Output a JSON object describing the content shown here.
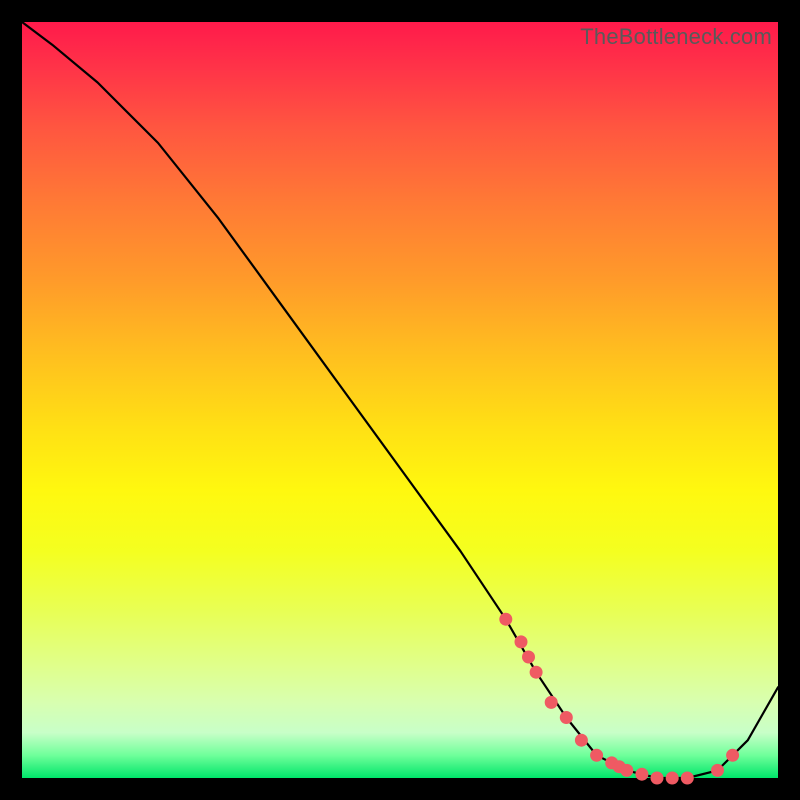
{
  "watermark": "TheBottleneck.com",
  "colors": {
    "frame_bg": "#000000",
    "marker": "#ef5a63",
    "curve": "#000000"
  },
  "chart_data": {
    "type": "line",
    "title": "",
    "xlabel": "",
    "ylabel": "",
    "xlim": [
      0,
      100
    ],
    "ylim": [
      0,
      100
    ],
    "series": [
      {
        "name": "bottleneck-curve",
        "x": [
          0,
          4,
          10,
          18,
          26,
          34,
          42,
          50,
          58,
          64,
          68,
          72,
          76,
          80,
          84,
          88,
          92,
          96,
          100
        ],
        "y": [
          100,
          97,
          92,
          84,
          74,
          63,
          52,
          41,
          30,
          21,
          14,
          8,
          3,
          1,
          0,
          0,
          1,
          5,
          12
        ]
      }
    ],
    "markers": {
      "name": "highlight-points",
      "x": [
        64,
        66,
        67,
        68,
        70,
        72,
        74,
        76,
        78,
        79,
        80,
        82,
        84,
        86,
        88,
        92,
        94
      ],
      "y": [
        21,
        18,
        16,
        14,
        10,
        8,
        5,
        3,
        2,
        1.5,
        1,
        0.5,
        0,
        0,
        0,
        1,
        3
      ]
    },
    "gradient_stops": [
      {
        "pos": 0,
        "color": "#ff1a4b"
      },
      {
        "pos": 50,
        "color": "#ffe114"
      },
      {
        "pos": 100,
        "color": "#00e56a"
      }
    ]
  }
}
